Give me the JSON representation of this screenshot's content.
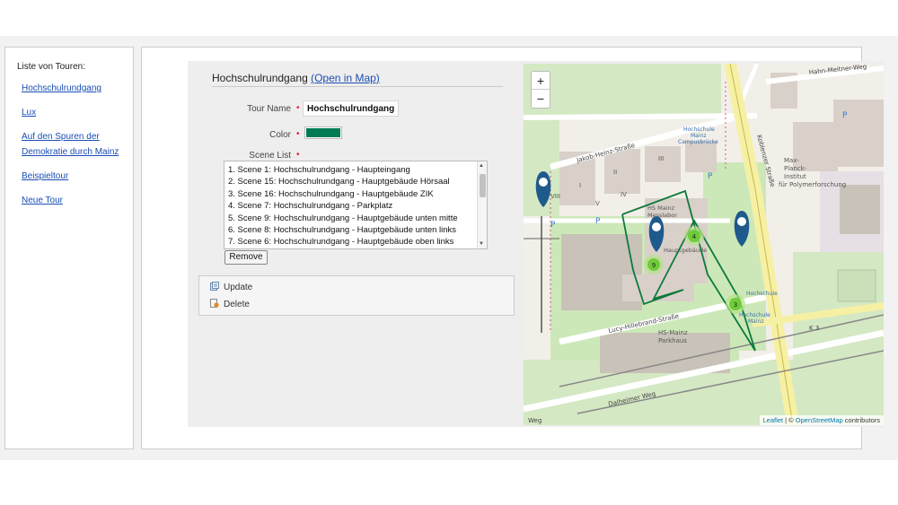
{
  "sidebar": {
    "title": "Liste von Touren:",
    "tours": [
      {
        "label": "Hochschulrundgang"
      },
      {
        "label": "Lux"
      },
      {
        "label": "Auf den Spuren der"
      },
      {
        "label": "Demokratie durch Mainz"
      },
      {
        "label": "Beispieltour"
      },
      {
        "label": "Neue Tour"
      }
    ]
  },
  "form": {
    "title": "Hochschulrundgang",
    "open_link": "(Open in Map)",
    "tour_name_label": "Tour Name",
    "tour_name_value": "Hochschulrundgang",
    "color_label": "Color",
    "color_value": "#007a55",
    "scene_list_label": "Scene List",
    "required_mark": "•",
    "scenes": [
      "1. Scene 1: Hochschulrundgang - Haupteingang",
      "2. Scene 15: Hochschulrundgang - Hauptgebäude Hörsaal",
      "3. Scene 16: Hochschulrundgang - Hauptgebäude ZIK",
      "4. Scene 7: Hochschulrundgang - Parkplatz",
      "5. Scene 9: Hochschulrundgang - Hauptgebäude unten mitte",
      "6. Scene 8: Hochschulrundgang - Hauptgebäude unten links",
      "7. Scene 6: Hochschulrundgang - Hauptgebäude oben links"
    ],
    "remove_label": "Remove"
  },
  "actions": {
    "update_label": "Update",
    "delete_label": "Delete"
  },
  "map": {
    "zoom_in": "+",
    "zoom_out": "−",
    "attribution_leaflet": "Leaflet",
    "attribution_sep": " | © ",
    "attribution_osm": "OpenStreetMap",
    "attribution_tail": " contributors",
    "streets": {
      "hahn": "Hahn-Meitner-Weg",
      "jakob": "Jakob-Heinz-Straße",
      "koblenzer": "Koblenzer Straße",
      "lucy": "Lucy-Hillebrand-Straße",
      "dalheimer": "Dalheimer Weg",
      "weg": "Weg",
      "k3": "K 3"
    },
    "places": {
      "campus1": "Hochschule",
      "campus2": "Mainz",
      "campus3": "Campusbrücke",
      "planck1": "Max-",
      "planck2": "Planck-",
      "planck3": "Institut",
      "planck4": "für Polymerforschung",
      "hs1": "HS Mainz",
      "hs2": "Messlabor",
      "haupt": "Hauptgebäude",
      "park1": "HS-Mainz",
      "park2": "Parkhaus",
      "hsm1": "Hochschule",
      "hsm2": "Mainz",
      "bus": "Hochschule",
      "r3": "III",
      "r2": "II",
      "r1": "I",
      "r4": "IV",
      "r5": "V",
      "r8": "VIII",
      "pin": "P"
    },
    "clusters": {
      "c4": "4",
      "c9": "9",
      "c3": "3"
    },
    "route_color": "#0e7a3c",
    "marker_color": "#1e5a8c"
  }
}
